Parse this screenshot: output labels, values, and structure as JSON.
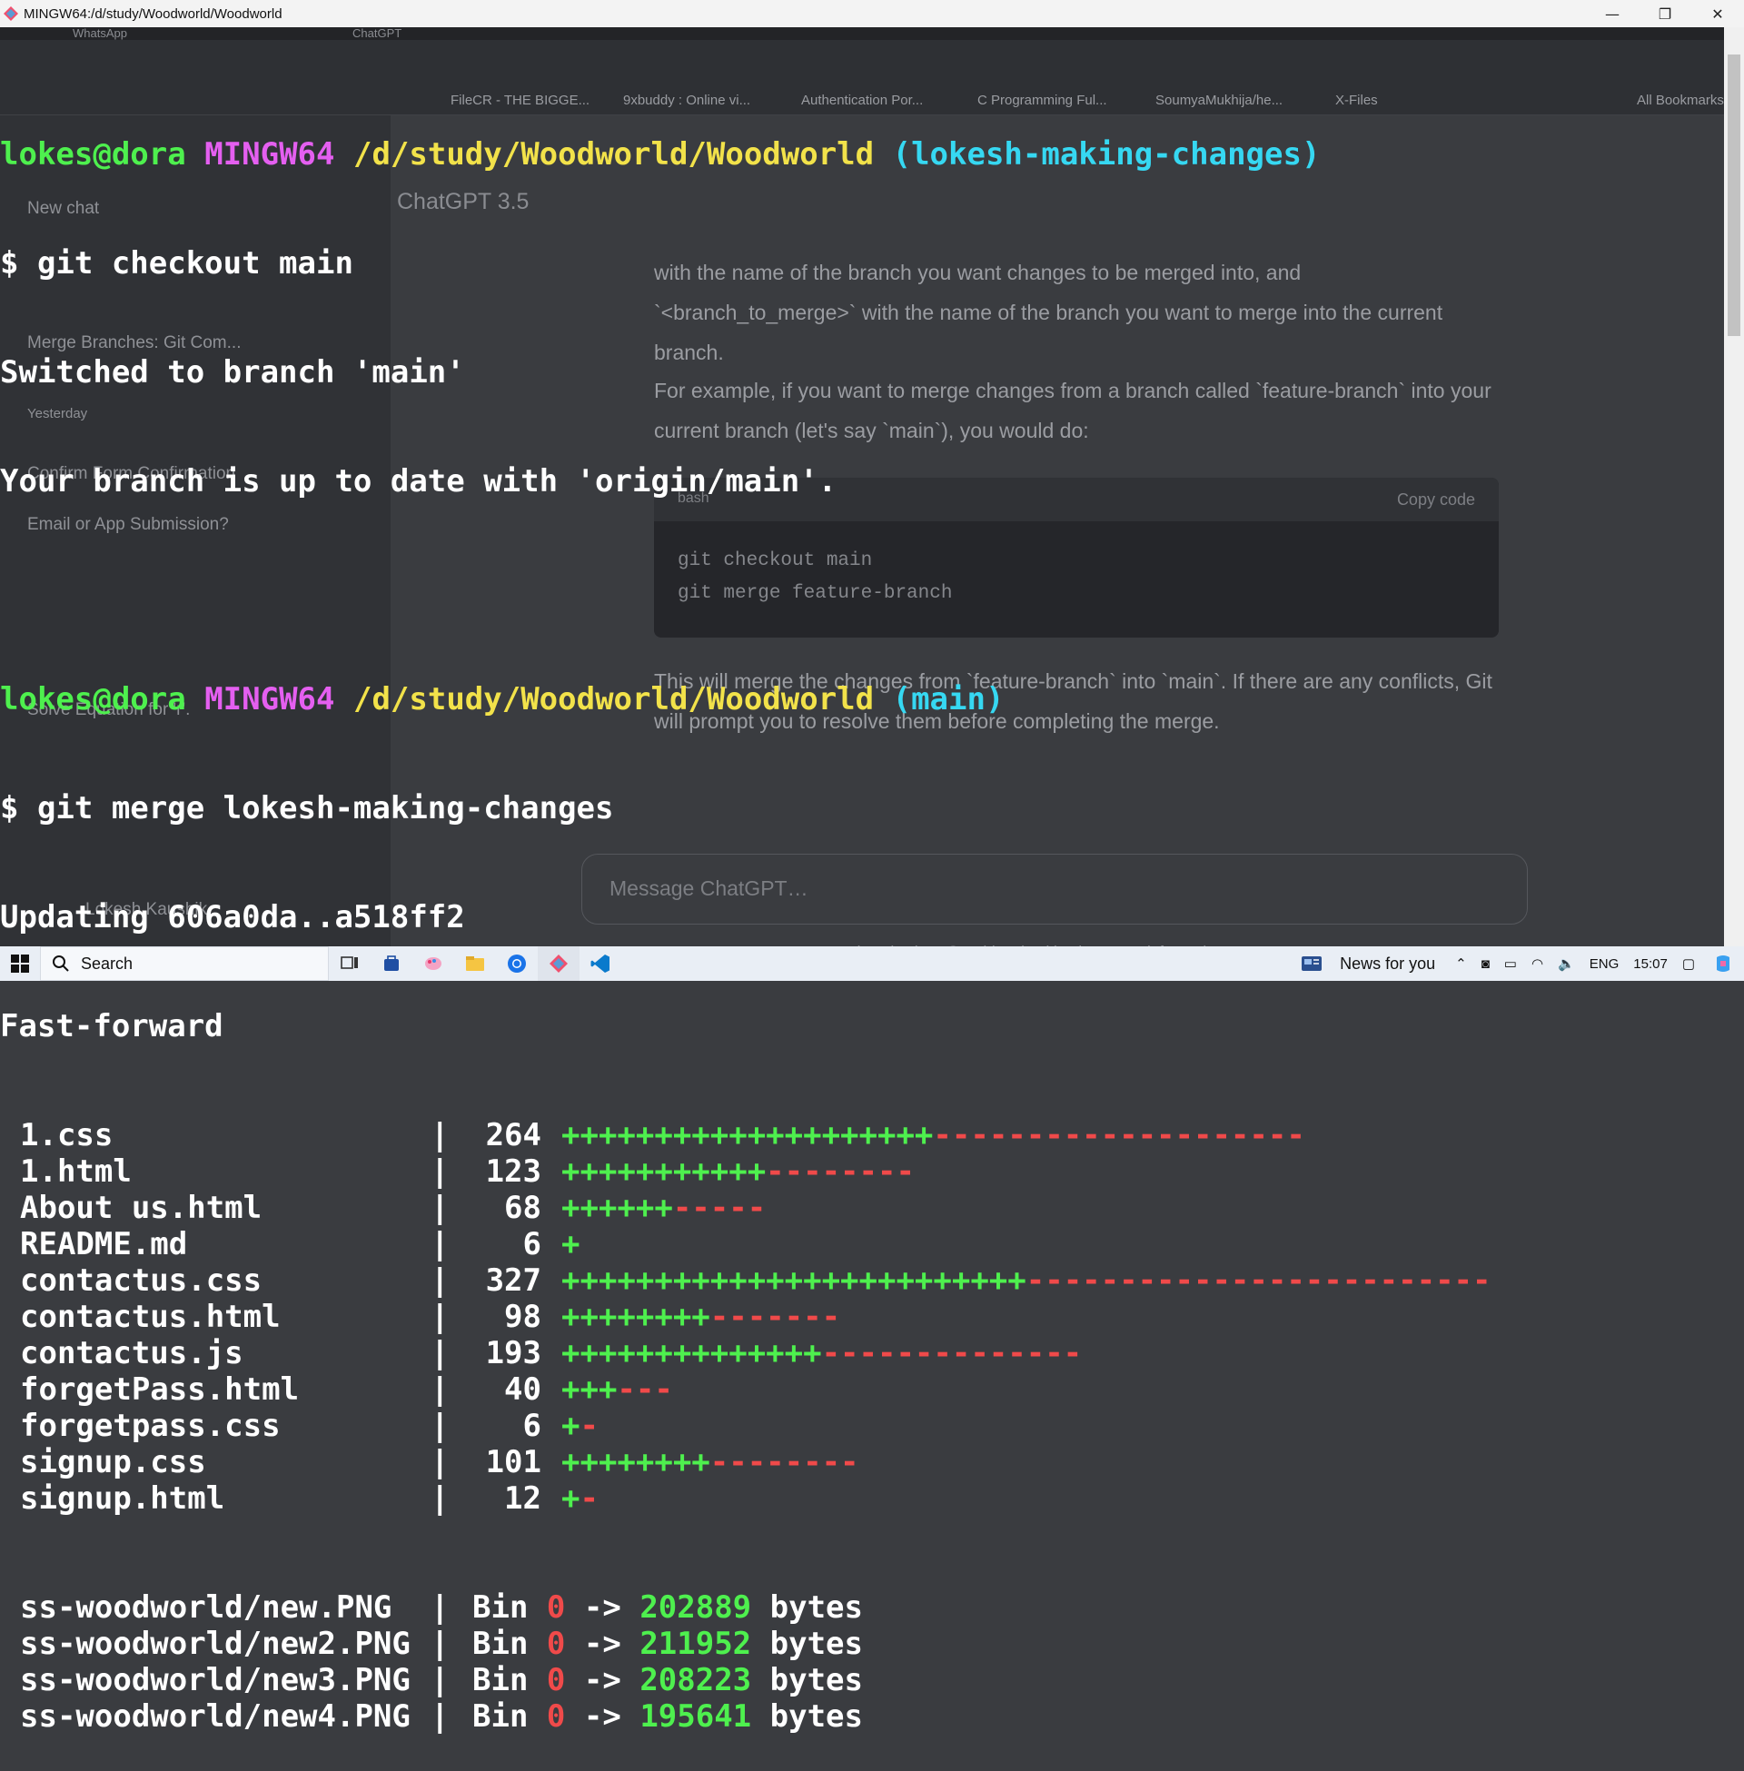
{
  "window": {
    "title": "MINGW64:/d/study/Woodworld/Woodworld",
    "controls": {
      "minimize": "—",
      "restore": "❐",
      "close": "✕"
    }
  },
  "terminal": {
    "prompt1": {
      "user": "lokes@dora",
      "host": "MINGW64",
      "path": "/d/study/Woodworld/Woodworld",
      "branch": "(lokesh-making-changes)"
    },
    "cmd1": "$ git checkout main",
    "out1": "Switched to branch 'main'",
    "out2": "Your branch is up to date with 'origin/main'.",
    "prompt2": {
      "user": "lokes@dora",
      "host": "MINGW64",
      "path": "/d/study/Woodworld/Woodworld",
      "branch": "(main)"
    },
    "cmd2": "$ git merge lokesh-making-changes",
    "out3": "Updating 606a0da..a518ff2",
    "out4": "Fast-forward",
    "text_files": [
      {
        "name": "1.css",
        "count": "264",
        "plus": "++++++++++++++++++++",
        "minus": "--------------------"
      },
      {
        "name": "1.html",
        "count": "123",
        "plus": "+++++++++++",
        "minus": "--------"
      },
      {
        "name": "About us.html",
        "count": "68",
        "plus": "++++++",
        "minus": "-----"
      },
      {
        "name": "README.md",
        "count": "6",
        "plus": "+",
        "minus": ""
      },
      {
        "name": "contactus.css",
        "count": "327",
        "plus": "+++++++++++++++++++++++++",
        "minus": "-------------------------"
      },
      {
        "name": "contactus.html",
        "count": "98",
        "plus": "++++++++",
        "minus": "-------"
      },
      {
        "name": "contactus.js",
        "count": "193",
        "plus": "++++++++++++++",
        "minus": "--------------"
      },
      {
        "name": "forgetPass.html",
        "count": "40",
        "plus": "+++",
        "minus": "---"
      },
      {
        "name": "forgetpass.css",
        "count": "6",
        "plus": "+",
        "minus": "-"
      },
      {
        "name": "signup.css",
        "count": "101",
        "plus": "++++++++",
        "minus": "--------"
      },
      {
        "name": "signup.html",
        "count": "12",
        "plus": "+",
        "minus": "-"
      }
    ],
    "bin_files": [
      {
        "name": "ss-woodworld/new.PNG",
        "bin": "Bin",
        "from": "0",
        "arrow": "->",
        "to": "202889",
        "unit": "bytes"
      },
      {
        "name": "ss-woodworld/new2.PNG",
        "bin": "Bin",
        "from": "0",
        "arrow": "->",
        "to": "211952",
        "unit": "bytes"
      },
      {
        "name": "ss-woodworld/new3.PNG",
        "bin": "Bin",
        "from": "0",
        "arrow": "->",
        "to": "208223",
        "unit": "bytes"
      },
      {
        "name": "ss-woodworld/new4.PNG",
        "bin": "Bin",
        "from": "0",
        "arrow": "->",
        "to": "195641",
        "unit": "bytes"
      }
    ]
  },
  "background_browser": {
    "tabs": [
      "WhatsApp",
      "ChatGPT"
    ],
    "bookmarks": [
      "FileCR - THE BIGGE...",
      "9xbuddy : Online vi...",
      "Authentication Por...",
      "C Programming Ful...",
      "SoumyaMukhija/he...",
      "X-Files",
      "All Bookmarks"
    ],
    "sidebar": [
      "New chat",
      "Merge Branches: Git Com...",
      "Yesterday",
      "Confirm Form Confirmation",
      "Email or App Submission?",
      "Solve Equation for 'r'.",
      "Lokesh Kaushik"
    ],
    "chat_title": "ChatGPT 3.5",
    "para1": "with the name of the branch you want changes to be merged into, and `<branch_to_merge>` with the name of the branch you want to merge into the current branch.",
    "para2": "For example, if you want to merge changes from a branch called `feature-branch` into your current branch (let's say `main`), you would do:",
    "code_lang": "bash",
    "copy_label": "Copy code",
    "code_lines": [
      "git checkout main",
      "git merge feature-branch"
    ],
    "para3": "This will merge the changes from `feature-branch` into `main`. If there are any conflicts, Git will prompt you to resolve them before completing the merge.",
    "message_placeholder": "Message ChatGPT…",
    "disclaimer": "make mistakes. Consider checking important information."
  },
  "taskbar": {
    "search_label": "Search",
    "news_label": "News for you",
    "lang": "ENG",
    "time": "15:07"
  },
  "colors": {
    "green": "#4ef04e",
    "magenta": "#e45ff0",
    "yellow": "#f2e24a",
    "cyan": "#36d8f2",
    "red": "#f04a4a"
  }
}
